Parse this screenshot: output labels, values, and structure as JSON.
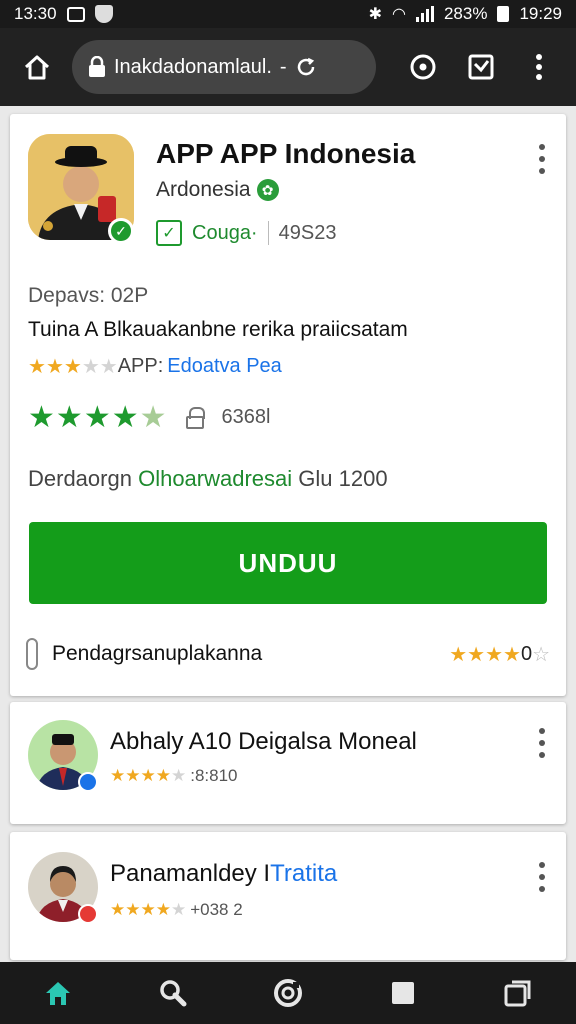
{
  "status_bar": {
    "time": "13:30",
    "battery": "283%",
    "clock": "19:29"
  },
  "browser": {
    "url": "Inakdadonamlaul.",
    "url_suffix": "-",
    "icons": [
      "home-icon",
      "lock-icon",
      "refresh-icon",
      "circle-icon",
      "checkbox-icon",
      "overflow-menu-icon"
    ]
  },
  "app": {
    "title": "APP APP Indonesia",
    "developer": "Ardonesia",
    "badge_label": "Couga·",
    "badge_count": "49S23",
    "details": "Depavs: 02P",
    "description": "Tuina A Blkauakanbne rerika praiicsatam",
    "rating_label": "APP:",
    "rating_link": "Edoatva Pea",
    "rating_stars_row1": 3,
    "rating_stars_row2": 4.5,
    "lock_text": "6368l",
    "download_prefix": "Derdaorgn",
    "download_green": "Olhoarwadresai",
    "download_suffix": "Glu 1200",
    "install_label": "UNDUU",
    "bottom_label": "Pendagrsanuplakanna",
    "bottom_rating_text": "0",
    "bottom_stars": 4
  },
  "reviews": [
    {
      "name": "Abhaly A10 Deigalsa Moneal",
      "name_highlight": "",
      "rating_text": ":8:810",
      "stars": 4,
      "badge_color": "#1a73e8"
    },
    {
      "name": "Panamanldey I",
      "name_highlight": "Tratita",
      "rating_text": "+038 2",
      "stars": 4,
      "badge_color": "#e53935"
    }
  ],
  "colors": {
    "accent_green": "#149d1a",
    "link_blue": "#1a73e8",
    "star_yellow": "#f0a820"
  },
  "nav": [
    "home-icon",
    "search-icon",
    "refresh-icon",
    "stop-icon",
    "tabs-icon"
  ]
}
